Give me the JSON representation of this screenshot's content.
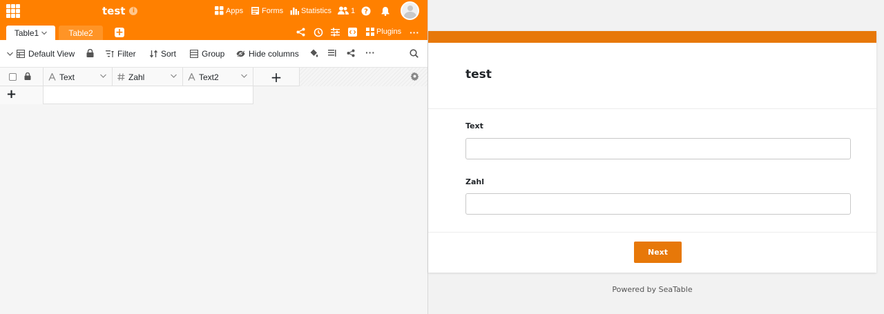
{
  "header": {
    "base_title": "test",
    "apps_label": "Apps",
    "forms_label": "Forms",
    "statistics_label": "Statistics",
    "collaborators_count": "1"
  },
  "tabs": {
    "active": "Table1",
    "inactive": "Table2"
  },
  "tools": {
    "plugins_label": "Plugins"
  },
  "toolbar": {
    "view_name": "Default View",
    "filter_label": "Filter",
    "sort_label": "Sort",
    "group_label": "Group",
    "hide_columns_label": "Hide columns"
  },
  "columns": [
    {
      "name": "Text",
      "type_icon": "text-icon"
    },
    {
      "name": "Zahl",
      "type_icon": "number-icon"
    },
    {
      "name": "Text2",
      "type_icon": "text-icon"
    }
  ],
  "form": {
    "title": "test",
    "fields": [
      {
        "label": "Text",
        "value": ""
      },
      {
        "label": "Zahl",
        "value": ""
      }
    ],
    "next_label": "Next",
    "powered_by": "Powered by SeaTable"
  },
  "colors": {
    "accent": "#ff8000",
    "form_accent": "#e77809"
  }
}
